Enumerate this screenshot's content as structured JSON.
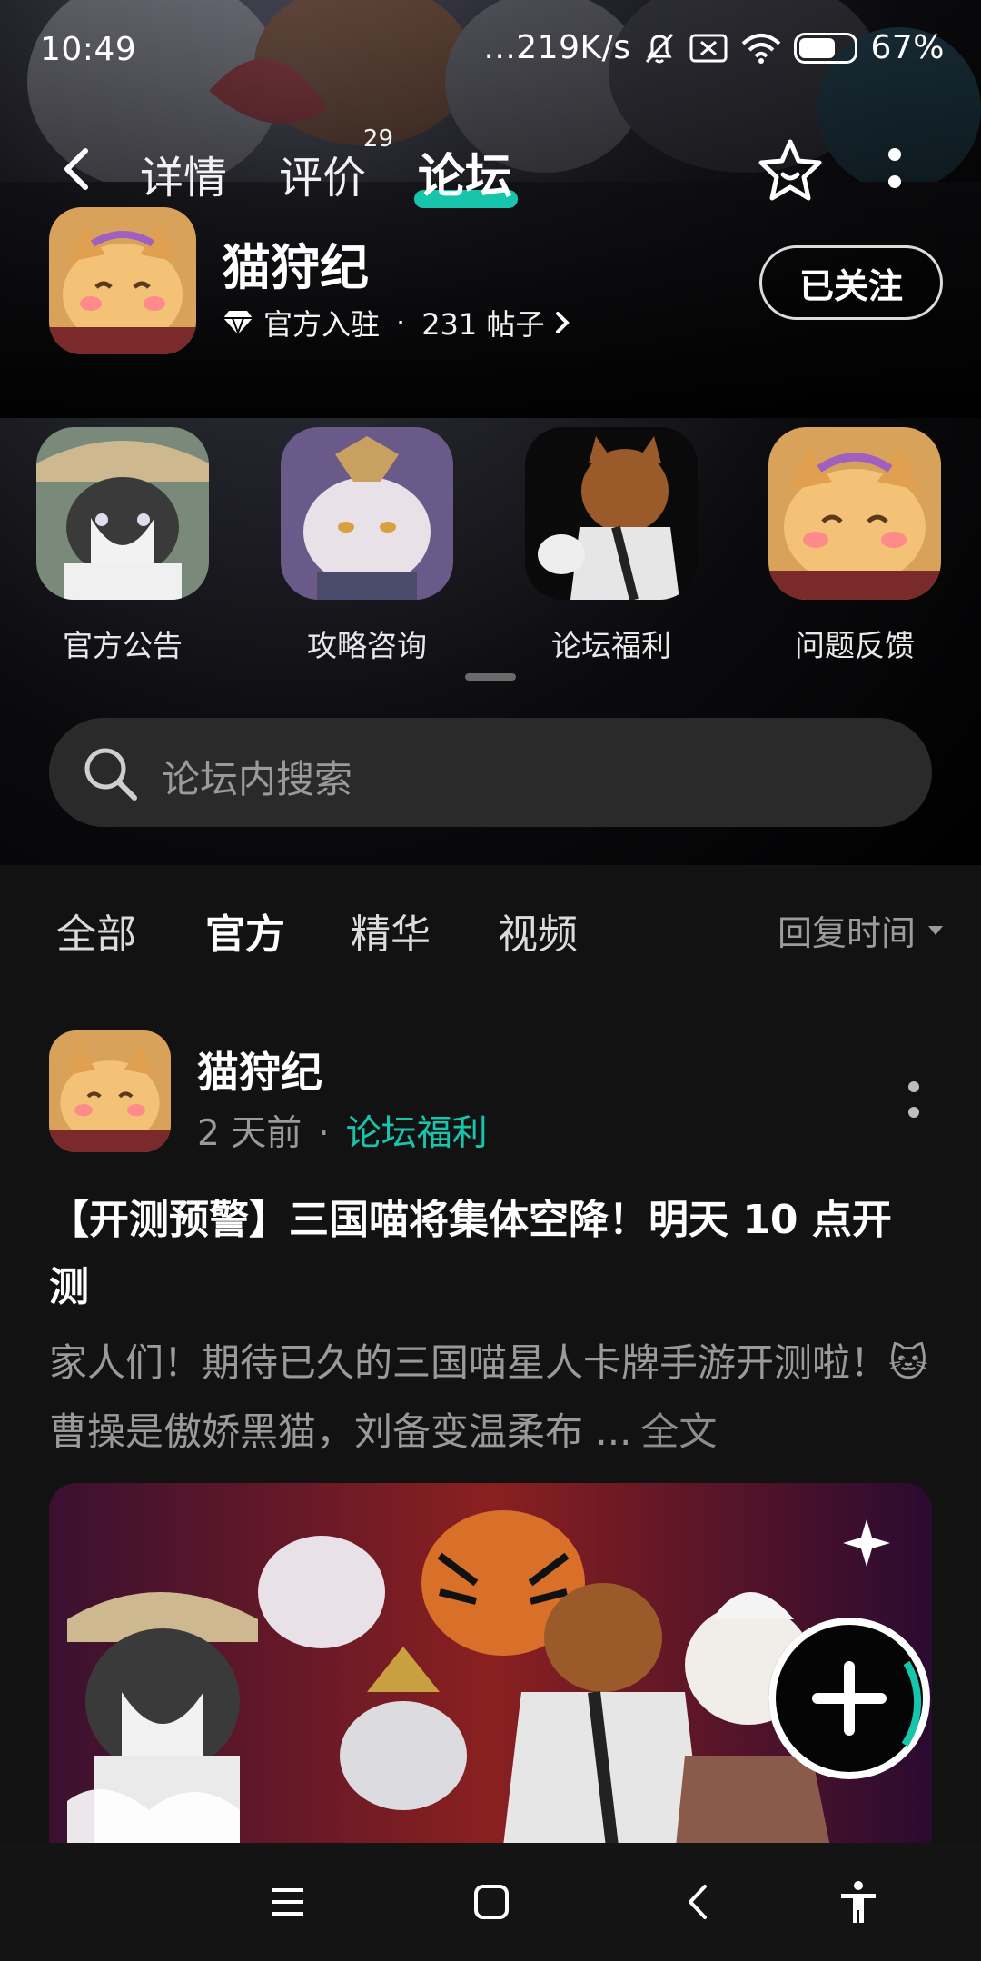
{
  "status_bar": {
    "time": "10:49",
    "speed": "...219K/s",
    "battery": "67%",
    "battery_level": 0.67
  },
  "nav": {
    "tabs": [
      {
        "label": "详情"
      },
      {
        "label": "评价",
        "badge": "29"
      },
      {
        "label": "论坛"
      }
    ],
    "active_tab": "论坛"
  },
  "app": {
    "name": "猫狩纪",
    "official_label": "官方入驻",
    "posts": "231 帖子",
    "follow_label": "已关注"
  },
  "categories": [
    {
      "label": "官方公告"
    },
    {
      "label": "攻略咨询"
    },
    {
      "label": "论坛福利"
    },
    {
      "label": "问题反馈"
    }
  ],
  "search": {
    "placeholder": "论坛内搜索"
  },
  "filters": {
    "tabs": [
      "全部",
      "官方",
      "精华",
      "视频"
    ],
    "active": "官方",
    "sort_label": "回复时间"
  },
  "post": {
    "author": "猫狩纪",
    "time": "2 天前",
    "forum": "论坛福利",
    "title": "【开测预警】三国喵将集体空降！明天 10 点开测",
    "excerpt": "家人们！期待已久的三国喵星人卡牌手游开测啦！🐱曹操是傲娇黑猫，刘备变温柔布 ...",
    "full_text_label": "全文"
  },
  "colors": {
    "accent": "#16c5ab",
    "background": "#121212"
  }
}
